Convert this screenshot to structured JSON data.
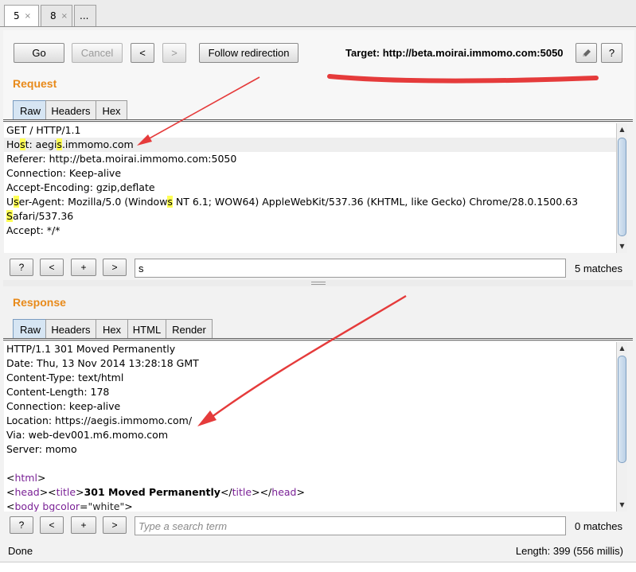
{
  "tabs": [
    {
      "label": "5",
      "close": "×",
      "active": true
    },
    {
      "label": "8",
      "close": "×",
      "active": false
    },
    {
      "label": "..."
    }
  ],
  "toolbar": {
    "go": "Go",
    "cancel": "Cancel",
    "back": "<",
    "forward": ">",
    "follow": "Follow redirection",
    "target_label": "Target: http://beta.moirai.immomo.com:5050",
    "edit_icon": "pencil-icon",
    "help": "?"
  },
  "request": {
    "title": "Request",
    "tabs": [
      "Raw",
      "Headers",
      "Hex"
    ],
    "lines": {
      "l1": "GET / HTTP/1.1",
      "l2a": "Ho",
      "l2b": "s",
      "l2c": "t: aegi",
      "l2d": "s",
      "l2e": ".immomo.com",
      "l3": "Referer: http://beta.moirai.immomo.com:5050",
      "l4": "Connection: Keep-alive",
      "l5": "Accept-Encoding: gzip,deflate",
      "l6a": "U",
      "l6b": "s",
      "l6c": "er-Agent: Mozilla/5.0 (Window",
      "l6d": "s",
      "l6e": " NT 6.1; WOW64) AppleWebKit/537.36 (KHTML, like Gecko) Chrome/28.0.1500.63",
      "l7a": "S",
      "l7b": "afari/537.36",
      "l8": "Accept: */*"
    },
    "search": {
      "help": "?",
      "prev": "<",
      "add": "+",
      "next": ">",
      "value": "s",
      "matches": "5 matches"
    }
  },
  "response": {
    "title": "Response",
    "tabs": [
      "Raw",
      "Headers",
      "Hex",
      "HTML",
      "Render"
    ],
    "lines": {
      "l1": "HTTP/1.1 301 Moved Permanently",
      "l2": "Date: Thu, 13 Nov 2014 13:28:18 GMT",
      "l3": "Content-Type: text/html",
      "l4": "Content-Length: 178",
      "l5": "Connection: keep-alive",
      "l6": "Location: https://aegis.immomo.com/",
      "l7": "Via: web-dev001.m6.momo.com",
      "l8": "Server: momo",
      "html_open": "html",
      "head": "head",
      "title_tag": "title",
      "title_text": "301 Moved Permanently",
      "body": "body",
      "bgcolor_attr": "bgcolor",
      "bgcolor_val": "\"white\""
    },
    "search": {
      "help": "?",
      "prev": "<",
      "add": "+",
      "next": ">",
      "placeholder": "Type a search term",
      "matches": "0 matches"
    }
  },
  "status": {
    "left": "Done",
    "right": "Length: 399 (556 millis)"
  },
  "colors": {
    "accent_orange": "#e88a1a",
    "annotation_red": "#e53b3b",
    "highlight_yellow": "#ffff55"
  }
}
